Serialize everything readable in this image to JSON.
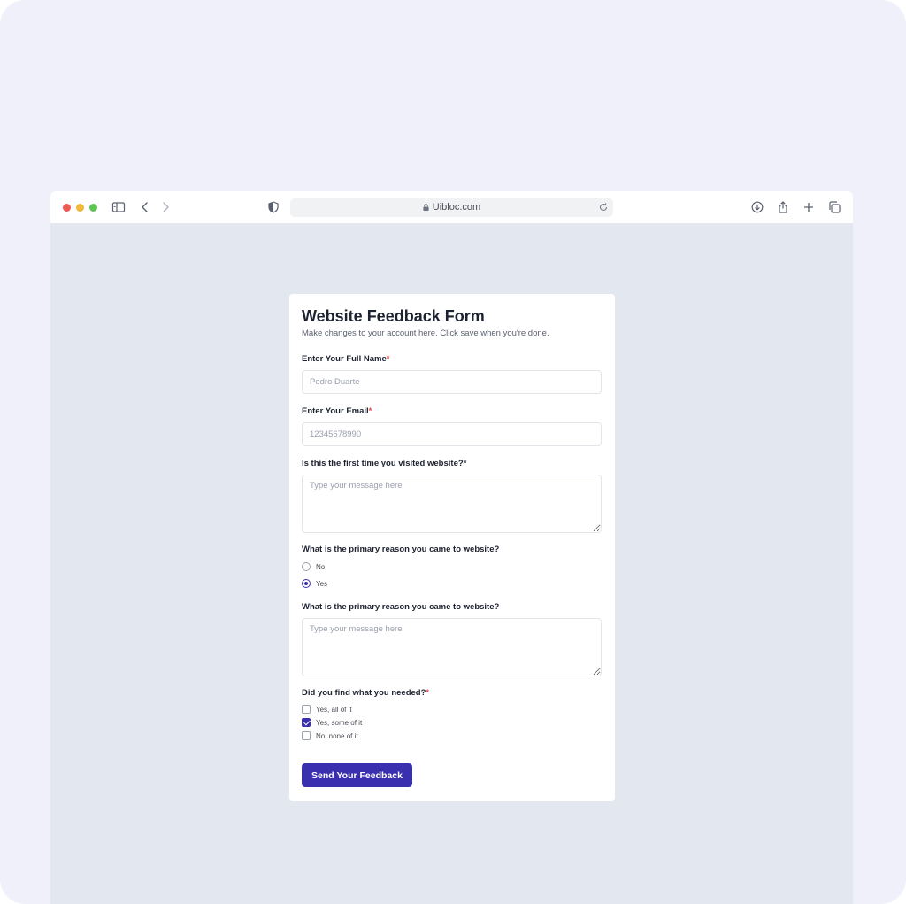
{
  "browser": {
    "url": "Uibloc.com"
  },
  "form": {
    "title": "Website Feedback Form",
    "subtitle": "Make changes to your account here. Click save when you're done.",
    "full_name": {
      "label": "Enter Your Full Name",
      "required_mark": "*",
      "placeholder": "Pedro Duarte"
    },
    "email": {
      "label": "Enter Your Email",
      "required_mark": "*",
      "placeholder": "12345678990"
    },
    "first_visit": {
      "label": "Is this the first time you visited website?*",
      "placeholder": "Type your message here"
    },
    "primary_reason_radio": {
      "label": "What is the primary reason you came to website?",
      "options": [
        {
          "label": "No",
          "checked": false
        },
        {
          "label": "Yes",
          "checked": true
        }
      ]
    },
    "primary_reason_text": {
      "label": "What is the primary reason you came to website?",
      "placeholder": "Type your message here"
    },
    "found_needed": {
      "label": "Did you find what you needed?",
      "required_mark": "*",
      "options": [
        {
          "label": "Yes, all of it",
          "checked": false
        },
        {
          "label": "Yes, some of it",
          "checked": true
        },
        {
          "label": "No, none of it",
          "checked": false
        }
      ]
    },
    "submit_label": "Send Your Feedback"
  },
  "colors": {
    "accent": "#3a2fae",
    "required": "#e5484d",
    "page_background": "#f0f0fb",
    "viewport_background": "#e3e7ef"
  },
  "icons": {
    "toolbar_left": [
      "sidebar-icon",
      "chevron-left-icon",
      "chevron-right-icon",
      "shield-icon"
    ],
    "toolbar_right": [
      "download-icon",
      "share-icon",
      "plus-icon",
      "tabs-icon"
    ],
    "url": [
      "lock-icon",
      "reload-icon"
    ]
  }
}
